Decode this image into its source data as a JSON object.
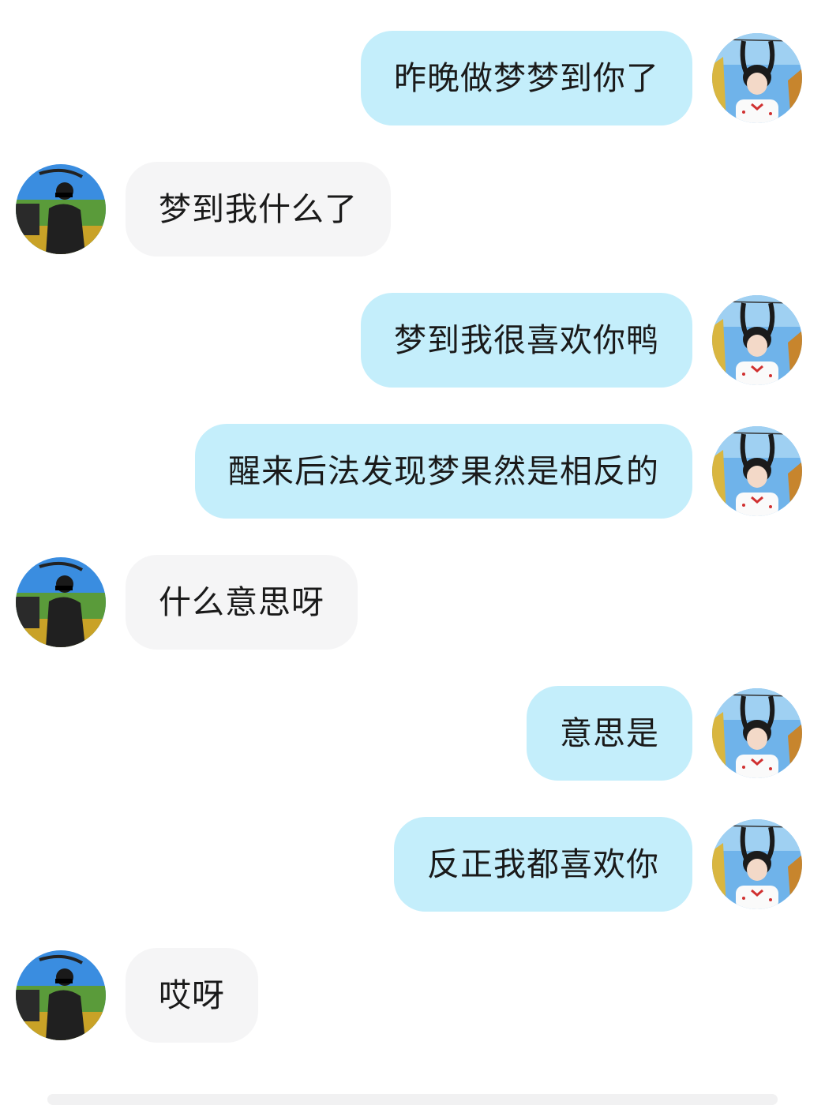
{
  "conversation": {
    "messages": [
      {
        "side": "right",
        "sender": "self",
        "text": "昨晚做梦梦到你了",
        "avatar": "girl-avatar"
      },
      {
        "side": "left",
        "sender": "other",
        "text": "梦到我什么了",
        "avatar": "boy-avatar"
      },
      {
        "side": "right",
        "sender": "self",
        "text": "梦到我很喜欢你鸭",
        "avatar": "girl-avatar"
      },
      {
        "side": "right",
        "sender": "self",
        "text": "醒来后法发现梦果然是相反的",
        "avatar": "girl-avatar"
      },
      {
        "side": "left",
        "sender": "other",
        "text": "什么意思呀",
        "avatar": "boy-avatar"
      },
      {
        "side": "right",
        "sender": "self",
        "text": "意思是",
        "avatar": "girl-avatar"
      },
      {
        "side": "right",
        "sender": "self",
        "text": "反正我都喜欢你",
        "avatar": "girl-avatar"
      },
      {
        "side": "left",
        "sender": "other",
        "text": "哎呀",
        "avatar": "boy-avatar"
      }
    ]
  },
  "colors": {
    "self_bubble": "#c4eefb",
    "other_bubble": "#f5f5f6",
    "text": "#1a1a1a",
    "background": "#ffffff"
  }
}
